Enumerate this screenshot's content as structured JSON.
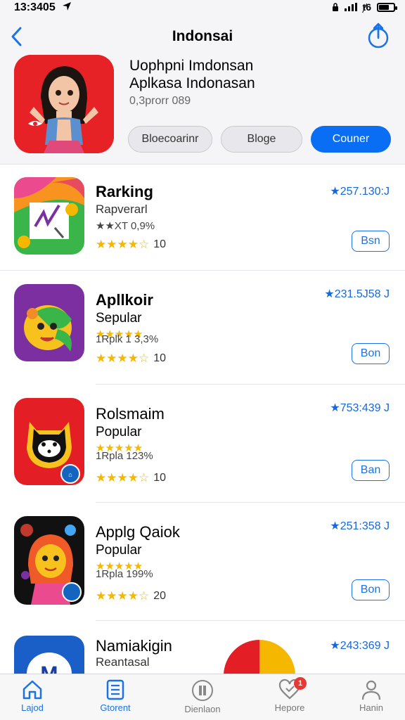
{
  "status_bar": {
    "time": "13:3405",
    "carrier_text": "ᐅ",
    "network": "ⱦ6"
  },
  "nav": {
    "title": "Indonsai",
    "back_icon": "chevron-left-icon",
    "share_icon": "share-icon"
  },
  "hero": {
    "title_line1": "Uophpni Imdonsan",
    "title_line2": "Aplkasa Indonasan",
    "subtitle": "0,3prorr 089",
    "buttons": [
      {
        "label": "Bloecoarinr"
      },
      {
        "label": "Bloge"
      },
      {
        "label": "Couner"
      }
    ]
  },
  "apps": [
    {
      "name": "Rarking",
      "line2": "Rapverarl",
      "line3": "★★XT 0,9%",
      "line4": "",
      "rating_value": "10",
      "stars": 4.5,
      "price": "★257.130:J",
      "action": "Bsn",
      "icon_bg": "#39b54a"
    },
    {
      "name": "Apllkoir",
      "line2": "Sepular",
      "line3": "★★★★★",
      "line4": "1Rplk 1 3,3%",
      "rating_value": "10",
      "stars": 4.5,
      "price": "★231.5J58 J",
      "action": "Bon",
      "icon_bg": "#7b2fa0"
    },
    {
      "name": "Rolsmaim",
      "line2": "Popular",
      "line3": "★★★★★",
      "line4": "1Rpla 123%",
      "rating_value": "10",
      "stars": 4.5,
      "price": "★753:439 J",
      "action": "Ban",
      "icon_bg": "#e31e24"
    },
    {
      "name": "Applg Qaiok",
      "line2": "Popular",
      "line3": "★★★★★",
      "line4": "1Rpla 199%",
      "rating_value": "20",
      "stars": 4.5,
      "price": "★251:358 J",
      "action": "Bon",
      "icon_bg": "#111111"
    },
    {
      "name": "Namiakigin",
      "line2": "Reantasal",
      "line3": "",
      "line4": "",
      "rating_value": "",
      "stars": 0,
      "price": "★243:369 J",
      "action": "",
      "icon_bg": "#1a5fc8"
    }
  ],
  "tabbar": {
    "tabs": [
      {
        "label": "Lajod",
        "icon": "home-icon",
        "active": true
      },
      {
        "label": "Gtorent",
        "icon": "list-icon",
        "active": true
      },
      {
        "label": "Dienlaon",
        "icon": "library-icon",
        "active": false
      },
      {
        "label": "Hepore",
        "icon": "heart-icon",
        "active": false,
        "badge": "1"
      },
      {
        "label": "Hanin",
        "icon": "person-icon",
        "active": false
      }
    ]
  }
}
